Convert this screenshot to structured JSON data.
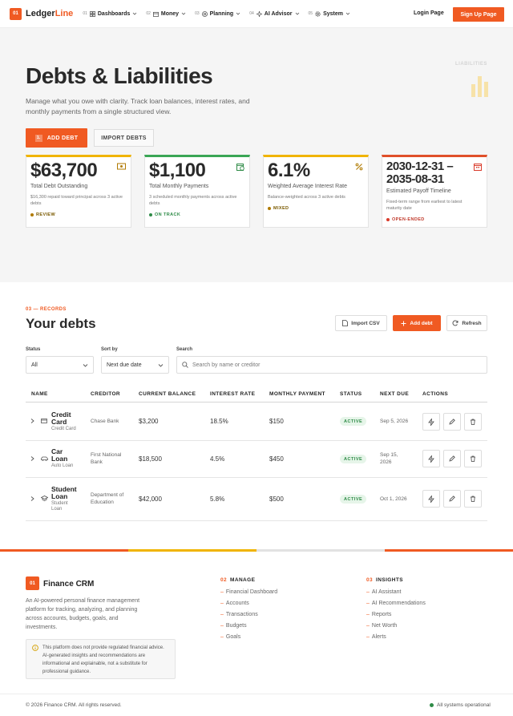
{
  "nav": {
    "logo_badge": "01",
    "logo_main": "Ledger",
    "logo_accent": "Line",
    "menu": [
      {
        "num": "01",
        "label": "Dashboards",
        "icon": "grid-icon"
      },
      {
        "num": "02",
        "label": "Money",
        "icon": "wallet-icon"
      },
      {
        "num": "03",
        "label": "Planning",
        "icon": "target-icon"
      },
      {
        "num": "04",
        "label": "AI Advisor",
        "icon": "sparkle-icon"
      },
      {
        "num": "05",
        "label": "System",
        "icon": "gear-icon"
      }
    ],
    "login": "Login Page",
    "signup": "Sign Up Page"
  },
  "hero": {
    "title": "Debts & Liabilities",
    "subtitle": "Manage what you owe with clarity. Track loan balances, interest rates, and monthly payments from a single structured view.",
    "add_icon_text": "1.",
    "add_button": "ADD DEBT",
    "import_button": "IMPORT DEBTS",
    "side_label": "LIABILITIES"
  },
  "cards": [
    {
      "value": "$63,700",
      "label": "Total Debt Outstanding",
      "desc": "$16,300 repaid toward principal across 3 active debts",
      "badge": "REVIEW",
      "color": "#f0b400",
      "badge_color": "#7a5a00",
      "icon": "money-icon"
    },
    {
      "value": "$1,100",
      "label": "Total Monthly Payments",
      "desc": "3 scheduled monthly payments across active debts",
      "badge": "ON TRACK",
      "color": "#3aa655",
      "badge_color": "#2e8b47",
      "icon": "calendar-clock-icon"
    },
    {
      "value": "6.1%",
      "label": "Weighted Average Interest Rate",
      "desc": "Balance-weighted across 3 active debts",
      "badge": "MIXED",
      "color": "#f0b400",
      "badge_color": "#7a5a00",
      "icon": "percent-icon"
    },
    {
      "value": "2030-12-31 – 2035-08-31",
      "label": "Estimated Payoff Timeline",
      "desc": "Fixed-term range from earliest to latest maturity date",
      "badge": "OPEN-ENDED",
      "color": "#e0502a",
      "badge_color": "#c0392b",
      "icon": "calendar-icon"
    }
  ],
  "records": {
    "tag": "03 — RECORDS",
    "title": "Your debts",
    "import_csv": "Import CSV",
    "add_debt": "Add debt",
    "refresh": "Refresh",
    "filters": {
      "status_label": "Status",
      "status_value": "All",
      "sort_label": "Sort by",
      "sort_value": "Next due date",
      "search_label": "Search",
      "search_placeholder": "Search by name or creditor"
    },
    "columns": [
      "NAME",
      "CREDITOR",
      "CURRENT BALANCE",
      "INTEREST RATE",
      "MONTHLY PAYMENT",
      "STATUS",
      "NEXT DUE",
      "ACTIONS"
    ],
    "rows": [
      {
        "name_1": "Credit",
        "name_2": "Card",
        "type": "Credit Card",
        "type_2": "",
        "creditor_1": "Chase Bank",
        "creditor_2": "",
        "balance": "$3,200",
        "rate": "18.5%",
        "payment": "$150",
        "status": "ACTIVE",
        "due_1": "Sep 5, 2026",
        "due_2": "",
        "icon": "card-icon"
      },
      {
        "name_1": "Car",
        "name_2": "Loan",
        "type": "Auto Loan",
        "type_2": "",
        "creditor_1": "First National",
        "creditor_2": "Bank",
        "balance": "$18,500",
        "rate": "4.5%",
        "payment": "$450",
        "status": "ACTIVE",
        "due_1": "Sep 15,",
        "due_2": "2026",
        "icon": "car-icon"
      },
      {
        "name_1": "Student",
        "name_2": "Loan",
        "type": "Student",
        "type_2": "Loan",
        "creditor_1": "Department of",
        "creditor_2": "Education",
        "balance": "$42,000",
        "rate": "5.8%",
        "payment": "$500",
        "status": "ACTIVE",
        "due_1": "Oct 1, 2026",
        "due_2": "",
        "icon": "graduation-cap-icon"
      }
    ]
  },
  "footer": {
    "logo_badge": "01",
    "name": "Finance CRM",
    "desc": "An AI-powered personal finance management platform for tracking, analyzing, and planning across accounts, budgets, goals, and investments.",
    "disclaimer": "This platform does not provide regulated financial advice. AI-generated insights and recommendations are informational and explainable, not a substitute for professional guidance.",
    "manage_num": "02",
    "manage_title": "MANAGE",
    "manage_links": [
      "Financial Dashboard",
      "Accounts",
      "Transactions",
      "Budgets",
      "Goals"
    ],
    "insights_num": "03",
    "insights_title": "INSIGHTS",
    "insights_links": [
      "AI Assistant",
      "AI Recommendations",
      "Reports",
      "Net Worth",
      "Alerts"
    ],
    "link_dash": "–",
    "copyright": "© 2026 Finance CRM. All rights reserved.",
    "status": "All systems operational"
  },
  "colors": {
    "accent": "#f05a22",
    "success": "#2e8b47",
    "warning": "#f0b400"
  }
}
